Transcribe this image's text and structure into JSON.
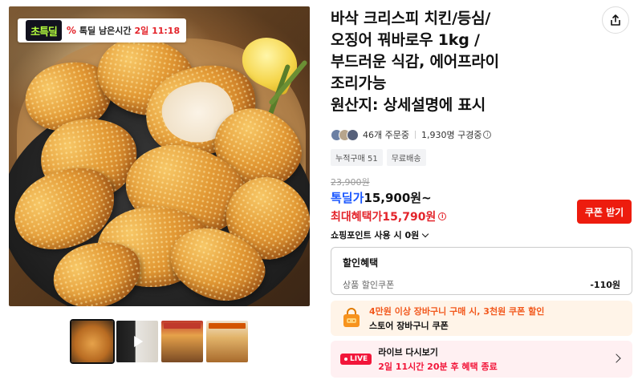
{
  "deal_badge": {
    "logo": "초특딜",
    "label": "톡딜 남은시간",
    "time": "2일 11:18"
  },
  "product": {
    "title": "바삭 크리스피 치킨/등심/\n오징어 꿔바로우 1kg /\n부드러운 식감, 에어프라이\n조리가능\n원산지: 상세설명에 표시"
  },
  "social": {
    "orders": "46개 주문중",
    "viewers": "1,930명 구경중"
  },
  "tags": [
    "누적구매 51",
    "무료배송"
  ],
  "price": {
    "original": "23,900원",
    "deal_label": "톡딜가",
    "deal_value": "15,900원~",
    "max_label": "최대혜택가",
    "max_value": "15,790원",
    "points": "쇼핑포인트 사용 시 0원",
    "coupon_button": "쿠폰 받기"
  },
  "discount": {
    "title": "할인혜택",
    "row_label": "상품 할인쿠폰",
    "row_amount": "-110원"
  },
  "cart_promo": {
    "line1": "4만원 이상 장바구니 구매 시, 3천원 쿠폰 할인",
    "line2": "스토어 장바구니 쿠폰"
  },
  "live": {
    "badge": "LIVE",
    "line1": "라이브 다시보기",
    "line2": "2일 11시간 20분 후 혜택 종료"
  },
  "icons": {
    "share": "share-icon",
    "info": "info-icon",
    "chevron_down": "chevron-down-icon",
    "chevron_right": "chevron-right-icon",
    "play": "play-icon",
    "shopping_bag": "shopping-bag-icon"
  },
  "colors": {
    "deal_blue": "#1a57ff",
    "benefit_red": "#e3242b",
    "coupon_button": "#ed1c0e",
    "promo_orange": "#f2581c",
    "live_pink": "#f2163a"
  }
}
